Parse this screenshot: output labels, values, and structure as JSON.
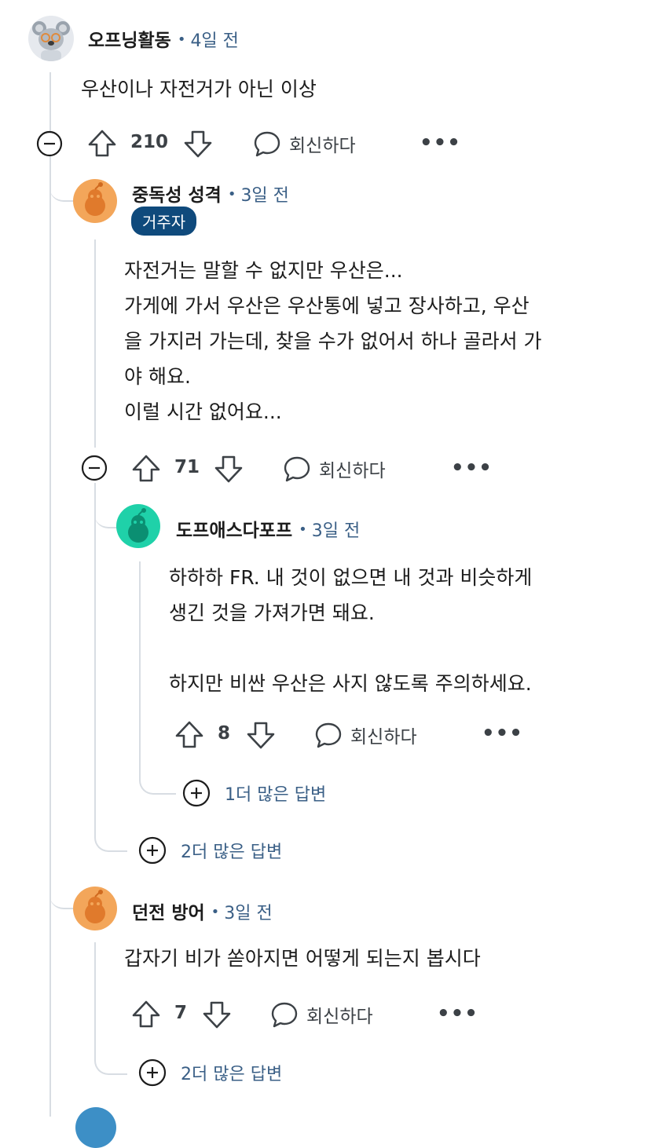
{
  "colors": {
    "thread_line": "#d8dde3",
    "meta": "#3a5f86",
    "badge_bg": "#0f4a7c",
    "text": "#1c1c1c"
  },
  "comments": [
    {
      "user": "오프닝활동",
      "time": "4일 전",
      "body": "우산이나 자전거가 아닌 이상",
      "score": "210",
      "reply_label": "회신하다",
      "avatar_icon": "koala-avatar-icon"
    },
    {
      "user": "중독성 성격",
      "time": "3일 전",
      "flair": "거주자",
      "body": "자전거는 말할 수 없지만 우산은...\n가게에 가서 우산은 우산통에 넣고 장사하고, 우산\n을 가지러 가는데, 찾을 수가 없어서 하나 골라서 가\n야 해요.\n이럴 시간 없어요...",
      "score": "71",
      "reply_label": "회신하다",
      "avatar_icon": "snoo-avatar-icon",
      "more_replies": "2더 많은 답변"
    },
    {
      "user": "도프애스다포프",
      "time": "3일 전",
      "body": "하하하 FR. 내 것이 없으면 내 것과 비슷하게\n생긴 것을 가져가면 돼요.\n\n하지만 비싼 우산은 사지 않도록 주의하세요.",
      "score": "8",
      "reply_label": "회신하다",
      "avatar_icon": "snoo-avatar-icon",
      "more_replies": "1더 많은 답변"
    },
    {
      "user": "던전 방어",
      "time": "3일 전",
      "body": "갑자기 비가 쏟아지면 어떻게 되는지 봅시다",
      "score": "7",
      "reply_label": "회신하다",
      "avatar_icon": "snoo-avatar-icon",
      "more_replies": "2더 많은 답변"
    }
  ]
}
